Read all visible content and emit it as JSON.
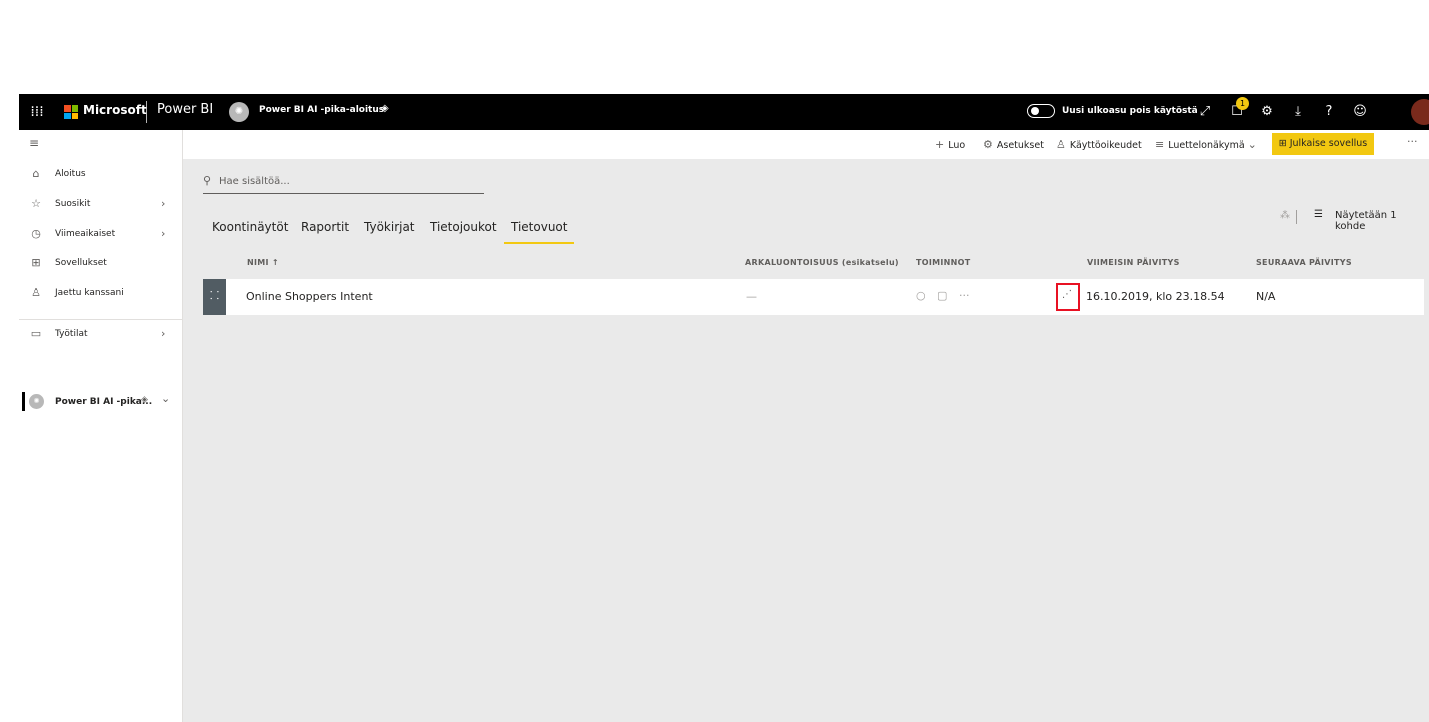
{
  "topbar": {
    "waffle_icon": "app-launcher-icon",
    "microsoft": "Microsoft",
    "app_name": "Power BI",
    "workspace_name": "Power BI AI -pika-aloitus",
    "toggle_label": "Uusi ulkoasu pois käytöstä",
    "notification_count": "1"
  },
  "sidebar": {
    "items": [
      {
        "label": "Aloitus",
        "icon": "home-icon"
      },
      {
        "label": "Suosikit",
        "icon": "star-icon"
      },
      {
        "label": "Viimeaikaiset",
        "icon": "clock-icon"
      },
      {
        "label": "Sovellukset",
        "icon": "apps-icon"
      },
      {
        "label": "Jaettu kanssani",
        "icon": "shared-icon"
      },
      {
        "label": "Työtilat",
        "icon": "workspaces-icon"
      }
    ],
    "current_workspace": "Power BI AI -pika..."
  },
  "commandbar": {
    "create": "Luo",
    "settings": "Asetukset",
    "access": "Käyttöoikeudet",
    "list_view": "Luettelonäkymä",
    "publish": "Julkaise sovellus"
  },
  "search": {
    "placeholder": "Hae sisältöä..."
  },
  "tabs": [
    "Koontinäytöt",
    "Raportit",
    "Työkirjat",
    "Tietojoukot",
    "Tietovuot"
  ],
  "active_tab": "Tietovuot",
  "view": {
    "count_label": "Näytetään 1 kohde"
  },
  "table": {
    "headers": {
      "name": "NIMI ↑",
      "sensitivity": "ARKALUONTOISUUS (esikatselu)",
      "actions": "TOIMINNOT",
      "last_refresh": "VIIMEISIN PÄIVITYS",
      "next_refresh": "SEURAAVA PÄIVITYS"
    },
    "rows": [
      {
        "name": "Online Shoppers Intent",
        "sensitivity": "—",
        "last_refresh": "16.10.2019, klo 23.18.54",
        "next_refresh": "N/A"
      }
    ]
  },
  "colors": {
    "topbar": "#000000",
    "accent": "#f2c811",
    "highlight": "#e81123"
  }
}
